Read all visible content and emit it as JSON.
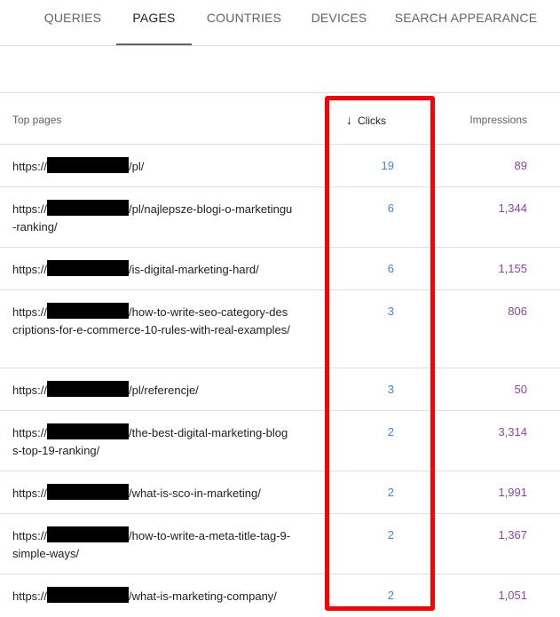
{
  "tabs": [
    {
      "label": "QUERIES"
    },
    {
      "label": "PAGES"
    },
    {
      "label": "COUNTRIES"
    },
    {
      "label": "DEVICES"
    },
    {
      "label": "SEARCH APPEARANCE"
    }
  ],
  "table": {
    "col_page": "Top pages",
    "col_clicks": "Clicks",
    "col_impressions": "Impressions",
    "rows": [
      {
        "prefix": "https://",
        "path": "/pl/",
        "clicks": "19",
        "impressions": "89"
      },
      {
        "prefix": "https://",
        "path": "/pl/najlepsze-blogi-o-marketingu-ranking/",
        "clicks": "6",
        "impressions": "1,344"
      },
      {
        "prefix": "https://",
        "path": "/is-digital-marketing-hard/",
        "clicks": "6",
        "impressions": "1,155"
      },
      {
        "prefix": "https://",
        "path": "/how-to-write-seo-category-descriptions-for-e-commerce-10-rules-with-real-examples/",
        "clicks": "3",
        "impressions": "806"
      },
      {
        "prefix": "https://",
        "path": "/pl/referencje/",
        "clicks": "3",
        "impressions": "50"
      },
      {
        "prefix": "https://",
        "path": "/the-best-digital-marketing-blogs-top-19-ranking/",
        "clicks": "2",
        "impressions": "3,314"
      },
      {
        "prefix": "https://",
        "path": "/what-is-sco-in-marketing/",
        "clicks": "2",
        "impressions": "1,991"
      },
      {
        "prefix": "https://",
        "path": "/how-to-write-a-meta-title-tag-9-simple-ways/",
        "clicks": "2",
        "impressions": "1,367"
      },
      {
        "prefix": "https://",
        "path": "/what-is-marketing-company/",
        "clicks": "2",
        "impressions": "1,051"
      }
    ]
  },
  "colors": {
    "clicks": "#4285f4",
    "impressions": "#8e44ad",
    "highlight": "#ff0000"
  },
  "icons": {
    "sort": "arrow-down-icon"
  }
}
